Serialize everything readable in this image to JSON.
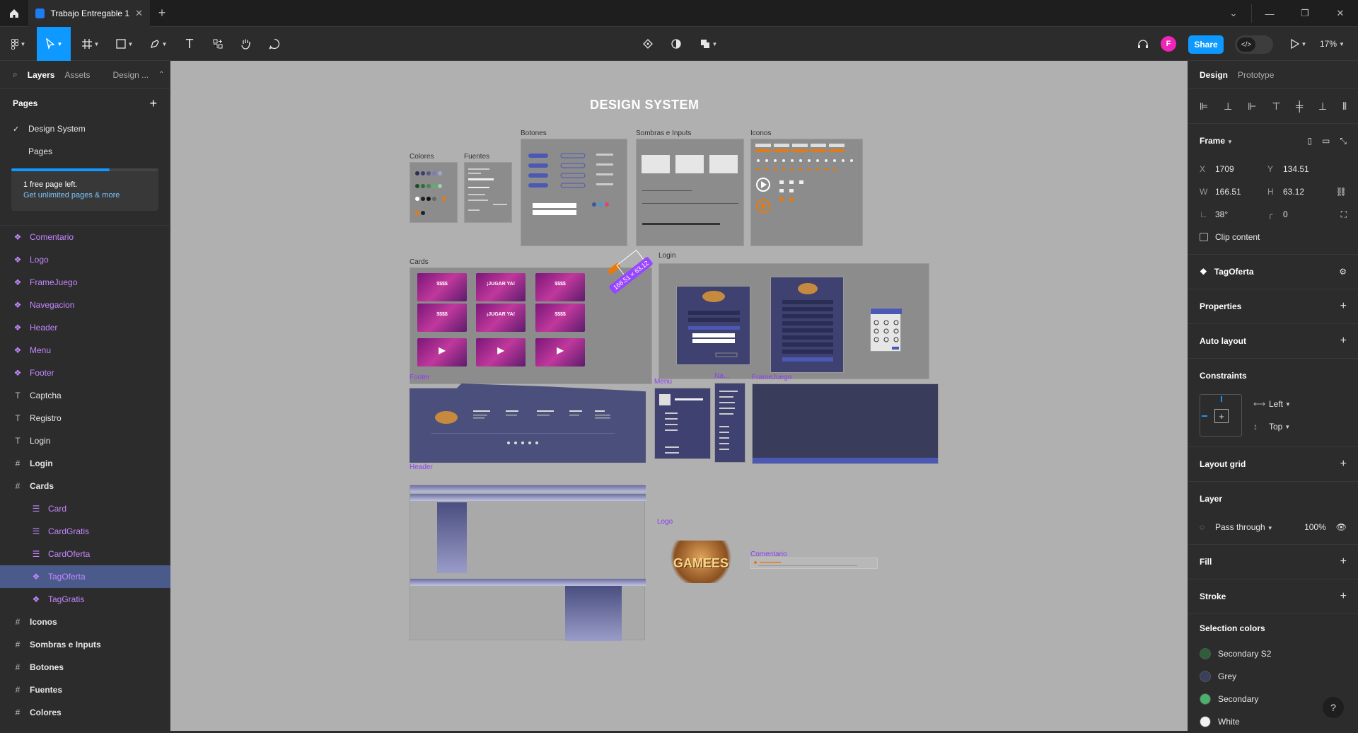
{
  "window": {
    "tab_title": "Trabajo Entregable 1",
    "tab_close": "✕",
    "new_tab": "+"
  },
  "toolbar": {
    "share_label": "Share",
    "avatar_initial": "F",
    "zoom": "17%"
  },
  "left_panel": {
    "tabs": [
      "Layers",
      "Assets",
      "Design ..."
    ],
    "pages_header": "Pages",
    "add_page": "+",
    "pages": [
      {
        "label": "Design System",
        "selected": true
      },
      {
        "label": "Pages",
        "selected": false
      }
    ],
    "upsell_line1": "1 free page left.",
    "upsell_line2": "Get unlimited pages & more",
    "layers": [
      {
        "label": "Comentario",
        "type": "component",
        "indent": 0
      },
      {
        "label": "Logo",
        "type": "component",
        "indent": 0
      },
      {
        "label": "FrameJuego",
        "type": "component",
        "indent": 0
      },
      {
        "label": "Navegacion",
        "type": "component",
        "indent": 0
      },
      {
        "label": "Header",
        "type": "component",
        "indent": 0
      },
      {
        "label": "Menu",
        "type": "component",
        "indent": 0
      },
      {
        "label": "Footer",
        "type": "component",
        "indent": 0
      },
      {
        "label": "Captcha",
        "type": "text",
        "indent": 0
      },
      {
        "label": "Registro",
        "type": "text",
        "indent": 0
      },
      {
        "label": "Login",
        "type": "text",
        "indent": 0
      },
      {
        "label": "Login",
        "type": "frame",
        "indent": 0
      },
      {
        "label": "Cards",
        "type": "frame",
        "indent": 0
      },
      {
        "label": "Card",
        "type": "component-set",
        "indent": 1
      },
      {
        "label": "CardGratis",
        "type": "component-set",
        "indent": 1
      },
      {
        "label": "CardOferta",
        "type": "component-set",
        "indent": 1
      },
      {
        "label": "TagOferta",
        "type": "component",
        "indent": 1,
        "selected": true
      },
      {
        "label": "TagGratis",
        "type": "component",
        "indent": 1
      },
      {
        "label": "Iconos",
        "type": "frame",
        "indent": 0
      },
      {
        "label": "Sombras e Inputs",
        "type": "frame",
        "indent": 0
      },
      {
        "label": "Botones",
        "type": "frame",
        "indent": 0
      },
      {
        "label": "Fuentes",
        "type": "frame",
        "indent": 0
      },
      {
        "label": "Colores",
        "type": "frame",
        "indent": 0
      }
    ]
  },
  "canvas": {
    "title": "DESIGN SYSTEM",
    "frame_labels": {
      "colores": "Colores",
      "fuentes": "Fuentes",
      "botones": "Botones",
      "sombras": "Sombras e Inputs",
      "iconos": "Iconos",
      "cards": "Cards",
      "login": "Login",
      "footer": "Footer",
      "menu": "Menu",
      "navegacion": "Na...",
      "framejuego": "FrameJuego",
      "header": "Header",
      "logo": "Logo",
      "comentario": "Comentario"
    },
    "card_texts": [
      "$$$$",
      "¡JUGAR YA!",
      "$$$$",
      "$$$$",
      "¡JUGAR YA!",
      "$$$$",
      "",
      "",
      ""
    ],
    "size_badge": "166.51 × 63.12",
    "logo_text": "GAMEES"
  },
  "right_panel": {
    "tabs": [
      "Design",
      "Prototype"
    ],
    "frame_label": "Frame",
    "x_label": "X",
    "x_value": "1709",
    "y_label": "Y",
    "y_value": "134.51",
    "w_label": "W",
    "w_value": "166.51",
    "h_label": "H",
    "h_value": "63.12",
    "rotation": "38°",
    "radius": "0",
    "clip_content": "Clip content",
    "component_name": "TagOferta",
    "sections": {
      "properties": "Properties",
      "auto_layout": "Auto layout",
      "constraints": "Constraints",
      "layout_grid": "Layout grid",
      "layer": "Layer",
      "fill": "Fill",
      "stroke": "Stroke",
      "selection_colors": "Selection colors"
    },
    "constraint_h": "Left",
    "constraint_v": "Top",
    "blend_mode": "Pass through",
    "opacity": "100%",
    "selection_colors": [
      {
        "name": "Secondary S2",
        "color": "#2e5e3a"
      },
      {
        "name": "Grey",
        "color": "#3a3f5c"
      },
      {
        "name": "Secondary",
        "color": "#4caf6a"
      },
      {
        "name": "White",
        "color": "#f2f2f2"
      }
    ],
    "help": "?"
  },
  "colors": {
    "accent": "#0d99ff",
    "component": "#c387ff",
    "selection": "#9747ff"
  }
}
